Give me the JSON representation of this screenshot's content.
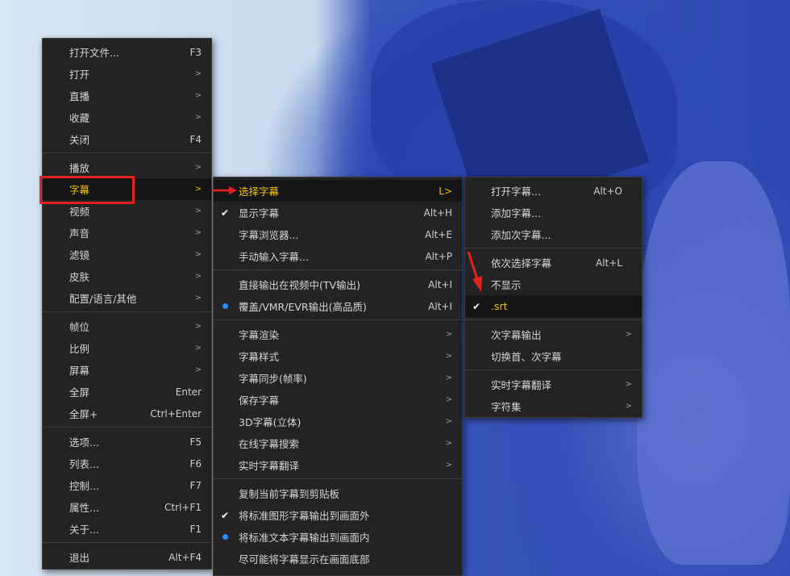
{
  "main_menu": {
    "items": [
      {
        "label": "打开文件...",
        "shortcut": "F3"
      },
      {
        "label": "打开",
        "arrow": ">"
      },
      {
        "label": "直播",
        "arrow": ">"
      },
      {
        "label": "收藏",
        "arrow": ">"
      },
      {
        "label": "关闭",
        "shortcut": "F4"
      },
      {
        "label": "播放",
        "arrow": ">"
      },
      {
        "label": "字幕",
        "arrow": ">"
      },
      {
        "label": "视频",
        "arrow": ">"
      },
      {
        "label": "声音",
        "arrow": ">"
      },
      {
        "label": "滤镜",
        "arrow": ">"
      },
      {
        "label": "皮肤",
        "arrow": ">"
      },
      {
        "label": "配置/语言/其他",
        "arrow": ">"
      },
      {
        "label": "帧位",
        "arrow": ">"
      },
      {
        "label": "比例",
        "arrow": ">"
      },
      {
        "label": "屏幕",
        "arrow": ">"
      },
      {
        "label": "全屏",
        "shortcut": "Enter"
      },
      {
        "label": "全屏+",
        "shortcut": "Ctrl+Enter"
      },
      {
        "label": "选项...",
        "shortcut": "F5"
      },
      {
        "label": "列表...",
        "shortcut": "F6"
      },
      {
        "label": "控制...",
        "shortcut": "F7"
      },
      {
        "label": "属性...",
        "shortcut": "Ctrl+F1"
      },
      {
        "label": "关于...",
        "shortcut": "F1"
      },
      {
        "label": "退出",
        "shortcut": "Alt+F4"
      }
    ]
  },
  "subtitle_menu": {
    "items": [
      {
        "label": "选择字幕",
        "shortcut": "L>"
      },
      {
        "label": "显示字幕",
        "shortcut": "Alt+H"
      },
      {
        "label": "字幕浏览器...",
        "shortcut": "Alt+E"
      },
      {
        "label": "手动输入字幕...",
        "shortcut": "Alt+P"
      },
      {
        "label": "直接输出在视频中(TV输出)",
        "shortcut": "Alt+I"
      },
      {
        "label": "覆盖/VMR/EVR输出(高品质)",
        "shortcut": "Alt+I"
      },
      {
        "label": "字幕渲染",
        "arrow": ">"
      },
      {
        "label": "字幕样式",
        "arrow": ">"
      },
      {
        "label": "字幕同步(帧率)",
        "arrow": ">"
      },
      {
        "label": "保存字幕",
        "arrow": ">"
      },
      {
        "label": "3D字幕(立体)",
        "arrow": ">"
      },
      {
        "label": "在线字幕搜索",
        "arrow": ">"
      },
      {
        "label": "实时字幕翻译",
        "arrow": ">"
      },
      {
        "label": "复制当前字幕到剪贴板"
      },
      {
        "label": "将标准图形字幕输出到画面外"
      },
      {
        "label": "将标准文本字幕输出到画面内"
      },
      {
        "label": "尽可能将字幕显示在画面底部"
      }
    ]
  },
  "select_menu": {
    "items": [
      {
        "label": "打开字幕...",
        "shortcut": "Alt+O"
      },
      {
        "label": "添加字幕..."
      },
      {
        "label": "添加次字幕..."
      },
      {
        "label": "依次选择字幕",
        "shortcut": "Alt+L"
      },
      {
        "label": "不显示"
      },
      {
        "label": ".srt"
      },
      {
        "label": "次字幕输出",
        "arrow": ">"
      },
      {
        "label": "切换首、次字幕"
      },
      {
        "label": "实时字幕翻译",
        "arrow": ">"
      },
      {
        "label": "字符集",
        "arrow": ">"
      }
    ]
  },
  "glyphs": {
    "check": "✔"
  },
  "colors": {
    "menu_bg": "#232323",
    "highlight_text": "#f5c400",
    "annotation_red": "#e52020",
    "radio_dot": "#2f8cff"
  }
}
